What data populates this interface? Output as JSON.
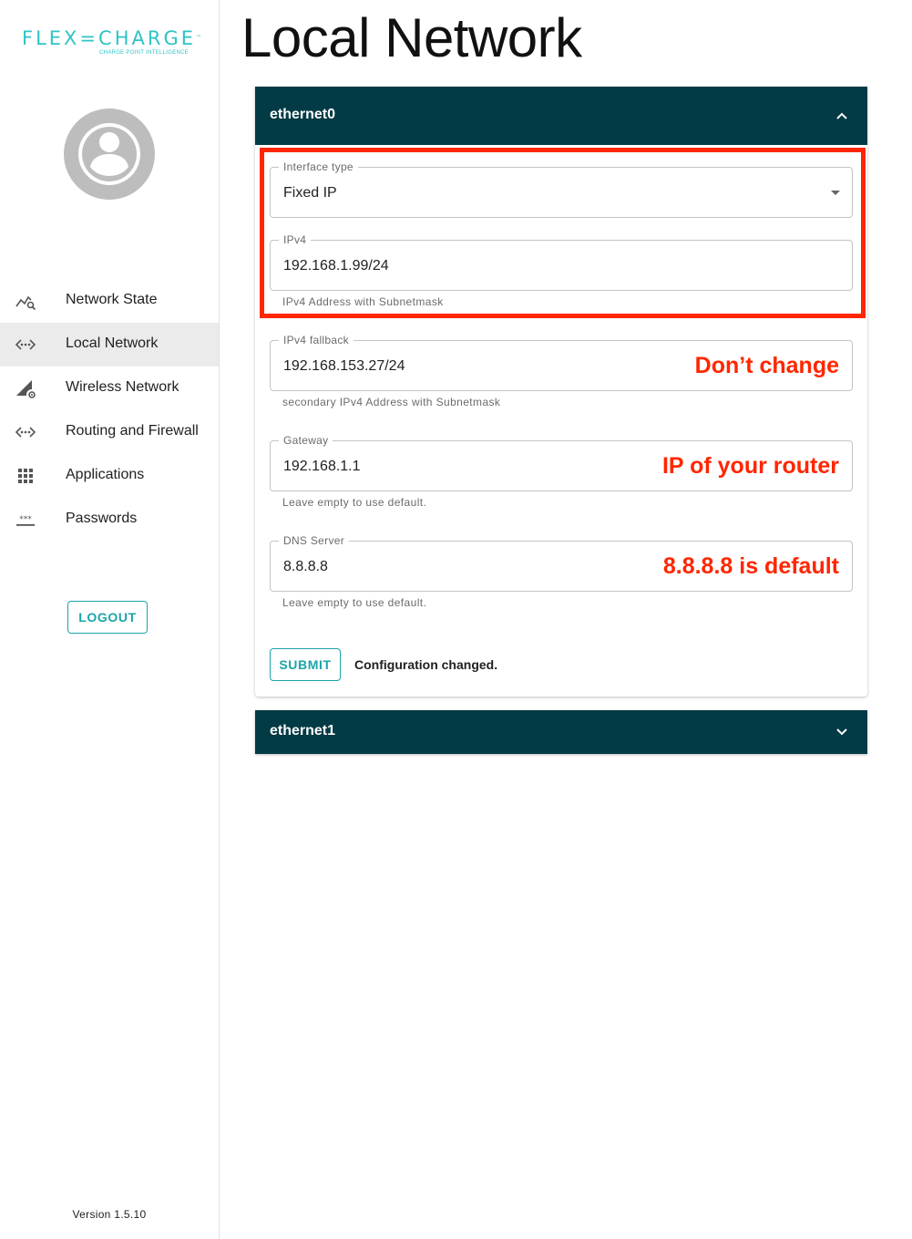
{
  "app": {
    "logo_text": "FLEX=CHARGE",
    "logo_tm": "™",
    "logo_tagline": "CHARGE POINT INTELLIGENCE",
    "brand_color": "#2ec4c6",
    "version": "Version 1.5.10"
  },
  "sidebar": {
    "items": [
      {
        "label": "Network State",
        "icon": "network-state-icon",
        "active": false
      },
      {
        "label": "Local Network",
        "icon": "local-network-icon",
        "active": true
      },
      {
        "label": "Wireless Network",
        "icon": "wireless-network-icon",
        "active": false
      },
      {
        "label": "Routing and Firewall",
        "icon": "routing-icon",
        "active": false
      },
      {
        "label": "Applications",
        "icon": "apps-grid-icon",
        "active": false
      },
      {
        "label": "Passwords",
        "icon": "password-icon",
        "active": false
      }
    ],
    "logout_label": "LOGOUT"
  },
  "main": {
    "title": "Local Network",
    "header_color": "#023a45",
    "accent_color": "#1aa5a8",
    "annotation_color": "#ff2600",
    "interfaces": [
      {
        "name": "ethernet0",
        "expanded": true,
        "fields": {
          "interface_type": {
            "label": "Interface type",
            "value": "Fixed IP"
          },
          "ipv4": {
            "label": "IPv4",
            "value": "192.168.1.99/24",
            "helper": "IPv4 Address with Subnetmask"
          },
          "ipv4_fallback": {
            "label": "IPv4 fallback",
            "value": "192.168.153.27/24",
            "helper": "secondary IPv4 Address with Subnetmask",
            "annotation": "Don’t change"
          },
          "gateway": {
            "label": "Gateway",
            "value": "192.168.1.1",
            "helper": "Leave empty to use default.",
            "annotation": "IP of your router"
          },
          "dns": {
            "label": "DNS Server",
            "value": "8.8.8.8",
            "helper": "Leave empty to use default.",
            "annotation": "8.8.8.8 is default"
          }
        },
        "submit_label": "SUBMIT",
        "status": "Configuration changed."
      },
      {
        "name": "ethernet1",
        "expanded": false
      }
    ]
  }
}
